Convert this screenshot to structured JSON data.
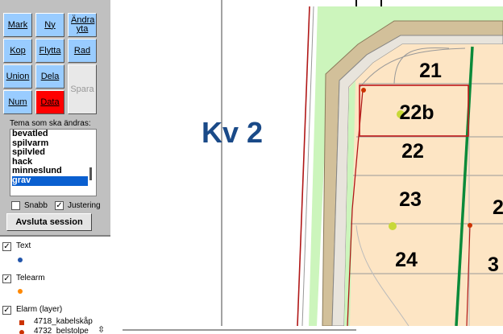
{
  "toolbar": {
    "mark": "Mark",
    "ny": "Ny",
    "andra": "Ändra yta",
    "kop": "Kop",
    "flytta": "Flytta",
    "rad": "Rad",
    "union": "Union",
    "dela": "Dela",
    "spara": "Spara",
    "num": "Num",
    "data": "Data"
  },
  "tema": {
    "label": "Tema som ska ändras:",
    "items": [
      "bevatled",
      "spilvarm",
      "spilvled",
      "hack",
      "minneslund",
      "grav"
    ],
    "selected": "grav"
  },
  "options": {
    "snabb": "Snabb",
    "snabb_checked": false,
    "justering": "Justering",
    "justering_checked": true
  },
  "end_session": "Avsluta session",
  "legend": {
    "text_layer": "Text",
    "telearm_layer": "Telearm",
    "elarm_layer": "Elarm (layer)",
    "elarm_item1": "4718_kabelskåp",
    "elarm_item2": "4732_belstolpe"
  },
  "map": {
    "block_label": "Kv 2",
    "plots": [
      "21",
      "22b",
      "22",
      "23",
      "24"
    ],
    "partial_plots": [
      "2",
      "3"
    ]
  },
  "colors": {
    "toolbutton": "#99ccff",
    "data_button": "#ff0000",
    "plot_fill": "#fde5c4",
    "green_strip": "#ccf5bc",
    "road": "#d2c09a",
    "kv_label": "#1a4a88"
  }
}
